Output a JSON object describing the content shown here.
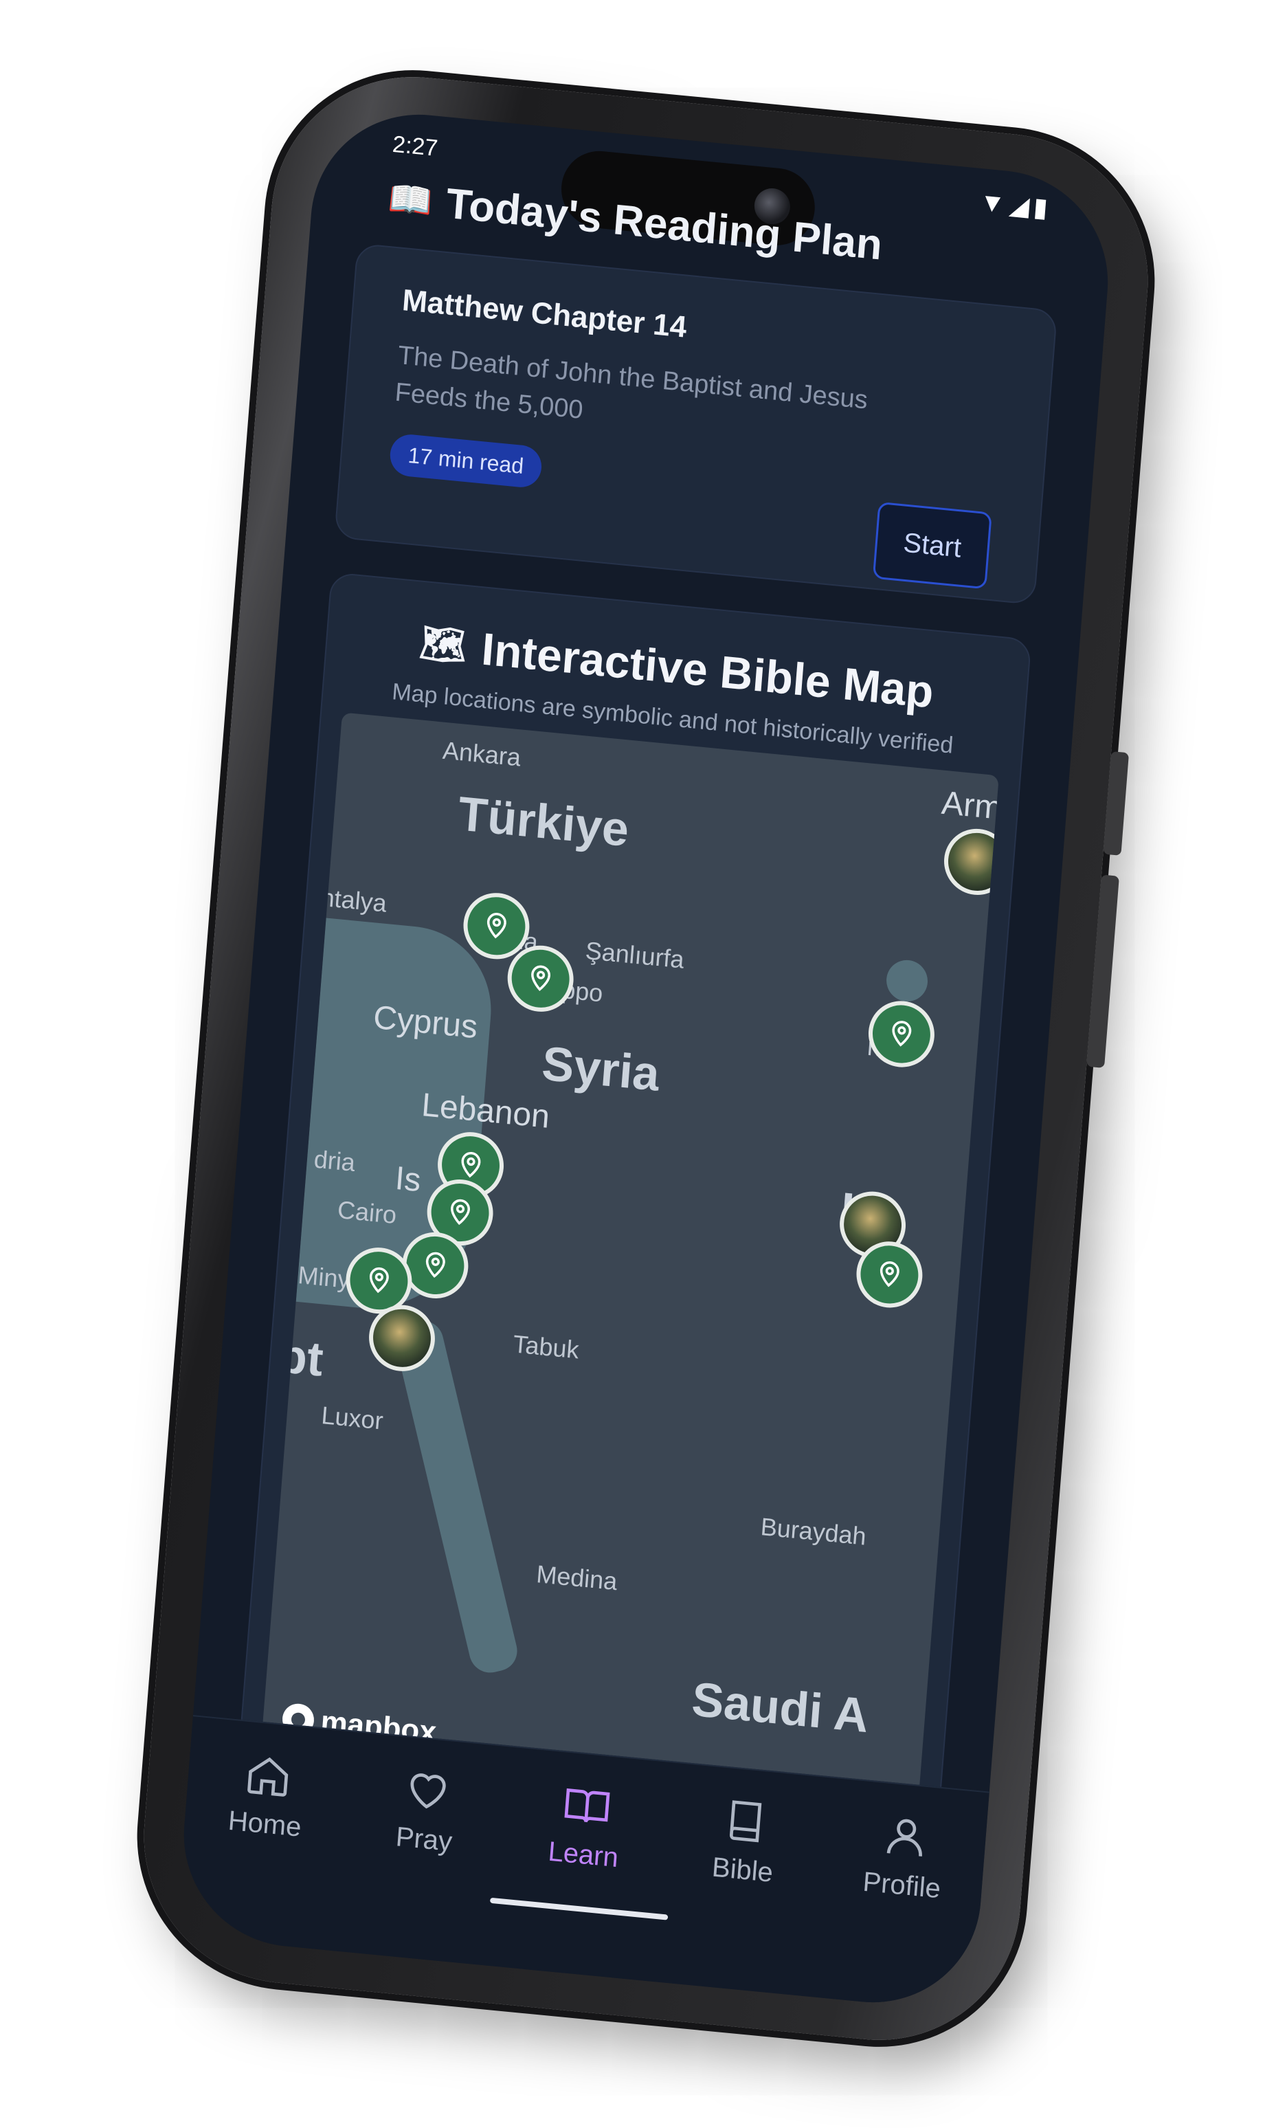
{
  "status_bar": {
    "time": "2:27",
    "icons": "▼◢▮"
  },
  "plan": {
    "title": "Today's Reading Plan",
    "title_icon": "book-open-icon",
    "chapter": "Matthew Chapter 14",
    "summary": "The Death of John the Baptist and Jesus Feeds the 5,000",
    "read_time": "17 min read",
    "start_label": "Start"
  },
  "map": {
    "title": "Interactive Bible Map",
    "title_icon": "map-icon",
    "note": "Map locations are symbolic and not historically verified",
    "attribution": "mapbox",
    "labels": {
      "ankara": "Ankara",
      "turkiye": "Türkiye",
      "antalya": "ntalya",
      "sanliurfa": "Şanlıurfa",
      "aleppo": "eppo",
      "adana": "na",
      "cyprus": "Cyprus",
      "syria": "Syria",
      "lebanon": "Lebanon",
      "israel": "Is",
      "iraq": "Ir",
      "erbil": "rbil",
      "armenia": "Arme",
      "cairo": "Cairo",
      "alexandria": "dria",
      "minya": "Minya",
      "egypt": "pt",
      "luxor": "Luxor",
      "tabuk": "Tabuk",
      "medina": "Medina",
      "buraydah": "Buraydah",
      "saudi": "Saudi A"
    }
  },
  "nav": [
    {
      "label": "Home",
      "icon": "home-icon",
      "active": false
    },
    {
      "label": "Pray",
      "icon": "heart-icon",
      "active": false
    },
    {
      "label": "Learn",
      "icon": "book-open-icon",
      "active": true
    },
    {
      "label": "Bible",
      "icon": "bible-icon",
      "active": false
    },
    {
      "label": "Profile",
      "icon": "user-icon",
      "active": false
    }
  ],
  "colors": {
    "background": "#131b29",
    "card": "#1e293b",
    "accent": "#c084fc",
    "badge": "#1d3aa6",
    "pin": "#2f7a4d"
  }
}
